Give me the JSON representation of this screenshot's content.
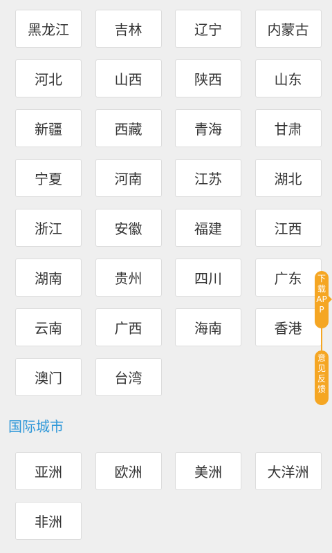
{
  "domestic_regions": [
    "黑龙江",
    "吉林",
    "辽宁",
    "内蒙古",
    "河北",
    "山西",
    "陕西",
    "山东",
    "新疆",
    "西藏",
    "青海",
    "甘肃",
    "宁夏",
    "河南",
    "江苏",
    "湖北",
    "浙江",
    "安徽",
    "福建",
    "江西",
    "湖南",
    "贵州",
    "四川",
    "广东",
    "云南",
    "广西",
    "海南",
    "香港",
    "澳门",
    "台湾"
  ],
  "international": {
    "title": "国际城市",
    "regions": [
      "亚洲",
      "欧洲",
      "美洲",
      "大洋洲",
      "非洲"
    ]
  },
  "side_tabs": {
    "download_app": "下载APP",
    "feedback": "意见反馈"
  },
  "colors": {
    "background": "#efefef",
    "cell_background": "#ffffff",
    "section_title": "#2d97d8",
    "side_tab": "#f5a623"
  }
}
